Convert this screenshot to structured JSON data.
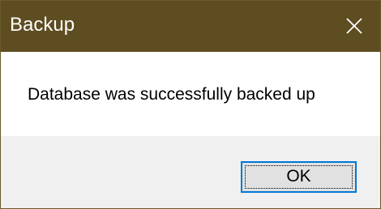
{
  "window": {
    "title": "Backup",
    "titlebar_color": "#5e4d21",
    "close_icon": "close-icon"
  },
  "content": {
    "message": "Database was successfully backed up"
  },
  "buttons": {
    "ok_label": "OK",
    "ok_border_color": "#0078d7"
  }
}
